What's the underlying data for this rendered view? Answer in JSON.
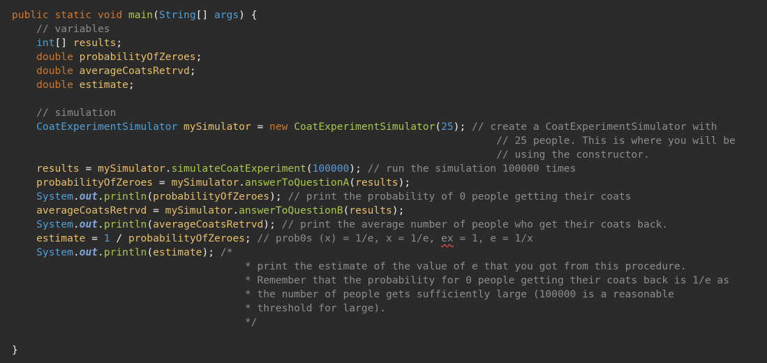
{
  "code_lines": [
    [
      {
        "t": "kw",
        "v": "public static void "
      },
      {
        "t": "method",
        "v": "main"
      },
      {
        "t": "plain",
        "v": "("
      },
      {
        "t": "type",
        "v": "String"
      },
      {
        "t": "plain",
        "v": "[] "
      },
      {
        "t": "type",
        "v": "args"
      },
      {
        "t": "plain",
        "v": ") {"
      }
    ],
    [
      {
        "t": "comment",
        "v": "    // variables"
      }
    ],
    [
      {
        "t": "type",
        "v": "    int"
      },
      {
        "t": "plain",
        "v": "[] "
      },
      {
        "t": "var",
        "v": "results"
      },
      {
        "t": "plain",
        "v": ";"
      }
    ],
    [
      {
        "t": "kw",
        "v": "    double "
      },
      {
        "t": "var",
        "v": "probabilityOfZeroes"
      },
      {
        "t": "plain",
        "v": ";"
      }
    ],
    [
      {
        "t": "kw",
        "v": "    double "
      },
      {
        "t": "var",
        "v": "averageCoatsRetrvd"
      },
      {
        "t": "plain",
        "v": ";"
      }
    ],
    [
      {
        "t": "kw",
        "v": "    double "
      },
      {
        "t": "var",
        "v": "estimate"
      },
      {
        "t": "plain",
        "v": ";"
      }
    ],
    [
      {
        "t": "plain",
        "v": ""
      }
    ],
    [
      {
        "t": "comment",
        "v": "    // simulation"
      }
    ],
    [
      {
        "t": "type",
        "v": "    CoatExperimentSimulator "
      },
      {
        "t": "var",
        "v": "mySimulator"
      },
      {
        "t": "plain",
        "v": " = "
      },
      {
        "t": "kw",
        "v": "new "
      },
      {
        "t": "method",
        "v": "CoatExperimentSimulator"
      },
      {
        "t": "plain",
        "v": "("
      },
      {
        "t": "num",
        "v": "25"
      },
      {
        "t": "plain",
        "v": "); "
      },
      {
        "t": "comment",
        "v": "// create a CoatExperimentSimulator with"
      }
    ],
    [
      {
        "t": "comment",
        "v": "                                                                               // 25 people. This is where you will be"
      }
    ],
    [
      {
        "t": "comment",
        "v": "                                                                               // using the constructor."
      }
    ],
    [
      {
        "t": "var",
        "v": "    results"
      },
      {
        "t": "plain",
        "v": " = "
      },
      {
        "t": "var",
        "v": "mySimulator"
      },
      {
        "t": "plain",
        "v": "."
      },
      {
        "t": "method",
        "v": "simulateCoatExperiment"
      },
      {
        "t": "plain",
        "v": "("
      },
      {
        "t": "num",
        "v": "100000"
      },
      {
        "t": "plain",
        "v": "); "
      },
      {
        "t": "comment",
        "v": "// run the simulation 100000 times"
      }
    ],
    [
      {
        "t": "var",
        "v": "    probabilityOfZeroes"
      },
      {
        "t": "plain",
        "v": " = "
      },
      {
        "t": "var",
        "v": "mySimulator"
      },
      {
        "t": "plain",
        "v": "."
      },
      {
        "t": "method",
        "v": "answerToQuestionA"
      },
      {
        "t": "plain",
        "v": "("
      },
      {
        "t": "var",
        "v": "results"
      },
      {
        "t": "plain",
        "v": ");"
      }
    ],
    [
      {
        "t": "type",
        "v": "    System"
      },
      {
        "t": "plain",
        "v": "."
      },
      {
        "t": "field",
        "v": "out"
      },
      {
        "t": "plain",
        "v": "."
      },
      {
        "t": "method",
        "v": "println"
      },
      {
        "t": "plain",
        "v": "("
      },
      {
        "t": "var",
        "v": "probabilityOfZeroes"
      },
      {
        "t": "plain",
        "v": "); "
      },
      {
        "t": "comment",
        "v": "// print the probability of 0 people getting their coats"
      }
    ],
    [
      {
        "t": "var",
        "v": "    averageCoatsRetrvd"
      },
      {
        "t": "plain",
        "v": " = "
      },
      {
        "t": "var",
        "v": "mySimulator"
      },
      {
        "t": "plain",
        "v": "."
      },
      {
        "t": "method",
        "v": "answerToQuestionB"
      },
      {
        "t": "plain",
        "v": "("
      },
      {
        "t": "var",
        "v": "results"
      },
      {
        "t": "plain",
        "v": ");"
      }
    ],
    [
      {
        "t": "type",
        "v": "    System"
      },
      {
        "t": "plain",
        "v": "."
      },
      {
        "t": "field",
        "v": "out"
      },
      {
        "t": "plain",
        "v": "."
      },
      {
        "t": "method",
        "v": "println"
      },
      {
        "t": "plain",
        "v": "("
      },
      {
        "t": "var",
        "v": "averageCoatsRetrvd"
      },
      {
        "t": "plain",
        "v": "); "
      },
      {
        "t": "comment",
        "v": "// print the average number of people who get their coats back."
      }
    ],
    [
      {
        "t": "var",
        "v": "    estimate"
      },
      {
        "t": "plain",
        "v": " = "
      },
      {
        "t": "num",
        "v": "1"
      },
      {
        "t": "plain",
        "v": " / "
      },
      {
        "t": "var",
        "v": "probabilityOfZeroes"
      },
      {
        "t": "plain",
        "v": "; "
      },
      {
        "t": "comment",
        "v": "// prob0s (x) = 1/e, x = 1/e, "
      },
      {
        "t": "squiggle",
        "v": "ex"
      },
      {
        "t": "comment",
        "v": " = 1, e = 1/x"
      }
    ],
    [
      {
        "t": "type",
        "v": "    System"
      },
      {
        "t": "plain",
        "v": "."
      },
      {
        "t": "field",
        "v": "out"
      },
      {
        "t": "plain",
        "v": "."
      },
      {
        "t": "method",
        "v": "println"
      },
      {
        "t": "plain",
        "v": "("
      },
      {
        "t": "var",
        "v": "estimate"
      },
      {
        "t": "plain",
        "v": "); "
      },
      {
        "t": "comment",
        "v": "/*"
      }
    ],
    [
      {
        "t": "comment",
        "v": "                                      * print the estimate of the value of e that you got from this procedure."
      }
    ],
    [
      {
        "t": "comment",
        "v": "                                      * Remember that the probability for 0 people getting their coats back is 1/e as"
      }
    ],
    [
      {
        "t": "comment",
        "v": "                                      * the number of people gets sufficiently large (100000 is a reasonable"
      }
    ],
    [
      {
        "t": "comment",
        "v": "                                      * threshold for large)."
      }
    ],
    [
      {
        "t": "comment",
        "v": "                                      */"
      }
    ],
    [
      {
        "t": "plain",
        "v": ""
      }
    ],
    [
      {
        "t": "plain",
        "v": "}"
      }
    ]
  ]
}
